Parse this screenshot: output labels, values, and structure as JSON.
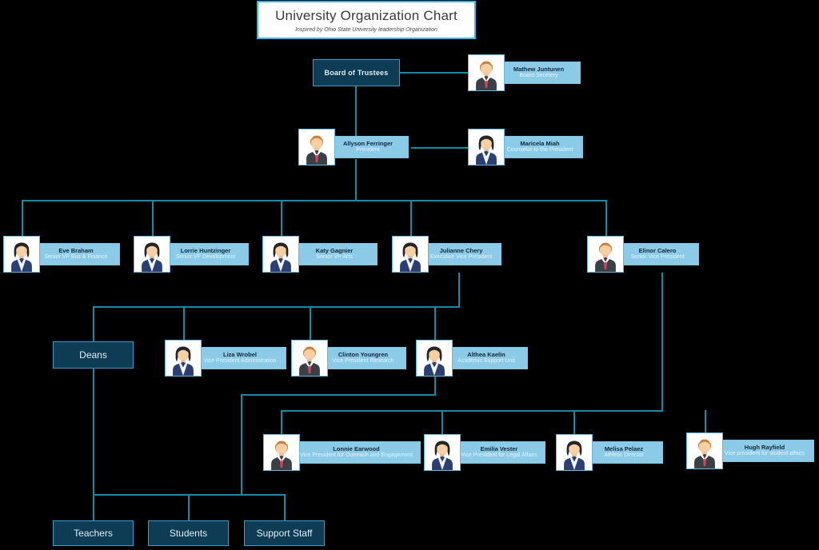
{
  "title": {
    "main": "University Organization Chart",
    "subtitle": "Inspired by Ohio State University leadership Organization"
  },
  "colors": {
    "background": "#000000",
    "unit_box_fill": "#0d3c54",
    "unit_box_border": "#3a9cc4",
    "person_strip": "#8ccbe8",
    "connector": "#158ca6",
    "title_border": "#35b5e8"
  },
  "units": {
    "board_of_trustees": "Board of Trustees",
    "deans": "Deans",
    "teachers": "Teachers",
    "students": "Students",
    "support_staff": "Support Staff"
  },
  "people": {
    "board_secretary": {
      "name": "Mathew Juntunen",
      "role": "Board Secetery",
      "avatar": "male"
    },
    "president": {
      "name": "Allyson Ferringer",
      "role": "President",
      "avatar": "male"
    },
    "counselor": {
      "name": "Maricela Miah",
      "role": "Counselor to the President",
      "avatar": "female"
    },
    "vp_bus_finance": {
      "name": "Eve Braham",
      "role": "Senior VP Bus & Finance",
      "avatar": "female"
    },
    "vp_development": {
      "name": "Lorrie Huntzinger",
      "role": "Senior VP Development",
      "avatar": "female"
    },
    "vp_arts": {
      "name": "Katy Gagnier",
      "role": "Senior VP Arts",
      "avatar": "female"
    },
    "evp": {
      "name": "Julianne Chery",
      "role": "Executive Vice President",
      "avatar": "female"
    },
    "svp": {
      "name": "Elinor Calero",
      "role": "Senior Vice President",
      "avatar": "male"
    },
    "vp_admin": {
      "name": "Liza Wrobel",
      "role": "Vice President Administration",
      "avatar": "female"
    },
    "vp_research": {
      "name": "Clinton Youngren",
      "role": "Vice President Research",
      "avatar": "male"
    },
    "academic_support": {
      "name": "Althea Kaelin",
      "role": "Academic Support Unit",
      "avatar": "female"
    },
    "vp_outreach": {
      "name": "Lonnie Earwood",
      "role": "Vice President for Outreach and Engagement",
      "avatar": "male"
    },
    "vp_legal": {
      "name": "Emilia Vester",
      "role": "Vice President for Legal Affairs",
      "avatar": "female"
    },
    "athletic_dir": {
      "name": "Melisa Pelaez",
      "role": "Athletic Director",
      "avatar": "female"
    },
    "vp_student": {
      "name": "Hugh Rayfield",
      "role": "Vice president for student affairs",
      "avatar": "male"
    }
  }
}
